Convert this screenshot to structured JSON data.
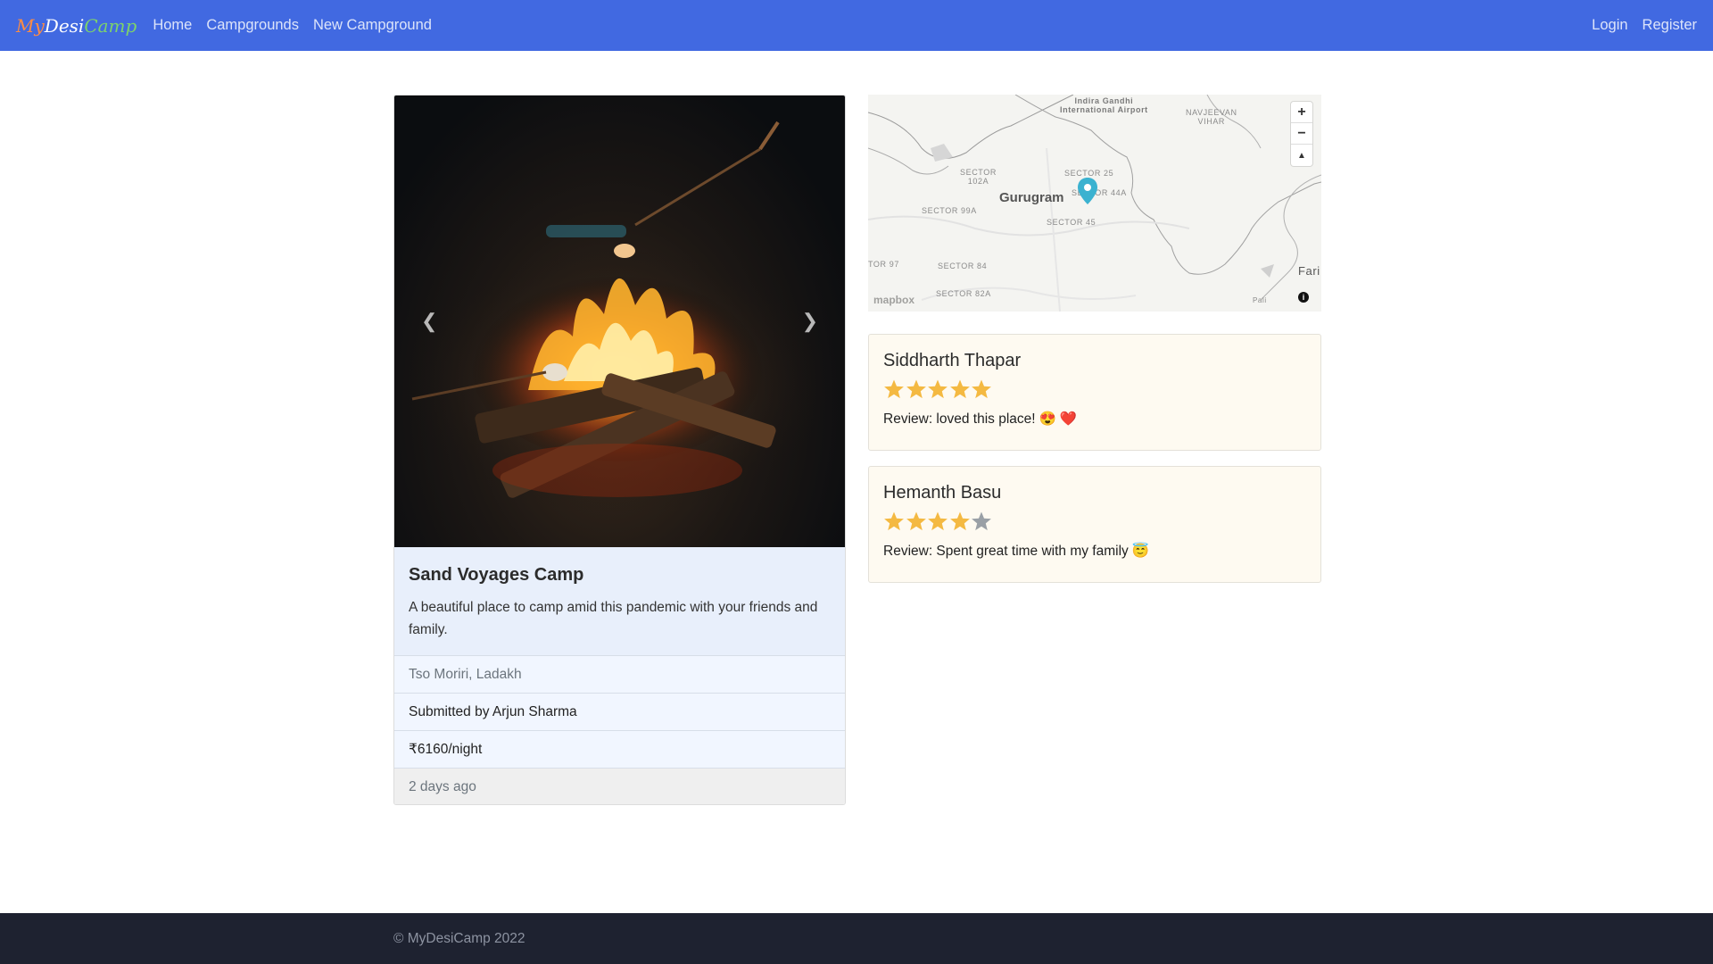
{
  "nav": {
    "brand": {
      "part1": "My",
      "part2": "Desi",
      "part3": "Camp"
    },
    "links": [
      "Home",
      "Campgrounds",
      "New Campground"
    ],
    "right_links": [
      "Login",
      "Register"
    ]
  },
  "campground": {
    "title": "Sand Voyages Camp",
    "description": "A beautiful place to camp amid this pandemic with your friends and family.",
    "location": "Tso Moriri, Ladakh",
    "submitted_by": "Submitted by Arjun Sharma",
    "price": "₹6160/night",
    "posted": "2 days ago"
  },
  "carousel": {
    "prev_icon": "chevron-left-icon",
    "next_icon": "chevron-right-icon"
  },
  "map": {
    "city": "Gurugram",
    "labels": {
      "airport_1": "Indira Gandhi",
      "airport_2": "International Airport",
      "navjeevan_1": "NAVJEEVAN",
      "navjeevan_2": "VIHAR",
      "sector102_1": "SECTOR",
      "sector102_2": "102A",
      "sector99a": "SECTOR 99A",
      "sector25": "SECTOR 25",
      "sector44a": "SECTOR 44A",
      "sector45": "SECTOR 45",
      "tor97": "TOR 97",
      "sector84": "SECTOR 84",
      "sector82a": "SECTOR 82A",
      "fari": "Fari",
      "pali": "Pali"
    },
    "zoom_in": "+",
    "zoom_out": "−",
    "compass": "▲",
    "attribution_logo": "mapbox",
    "info": "i",
    "marker_color": "#3bb2d0"
  },
  "reviews": [
    {
      "author": "Siddharth Thapar",
      "rating": 5,
      "text": "Review: loved this place!",
      "emojis": [
        "😍",
        "❤️"
      ]
    },
    {
      "author": "Hemanth Basu",
      "rating": 4,
      "text": "Review: Spent great time with my family",
      "emojis": [
        "😇"
      ]
    }
  ],
  "colors": {
    "navbar": "#4169e1",
    "star_filled": "#f4b942",
    "star_empty": "#9aa0a6",
    "footer": "#1e2230"
  },
  "footer": {
    "text": "© MyDesiCamp 2022"
  }
}
